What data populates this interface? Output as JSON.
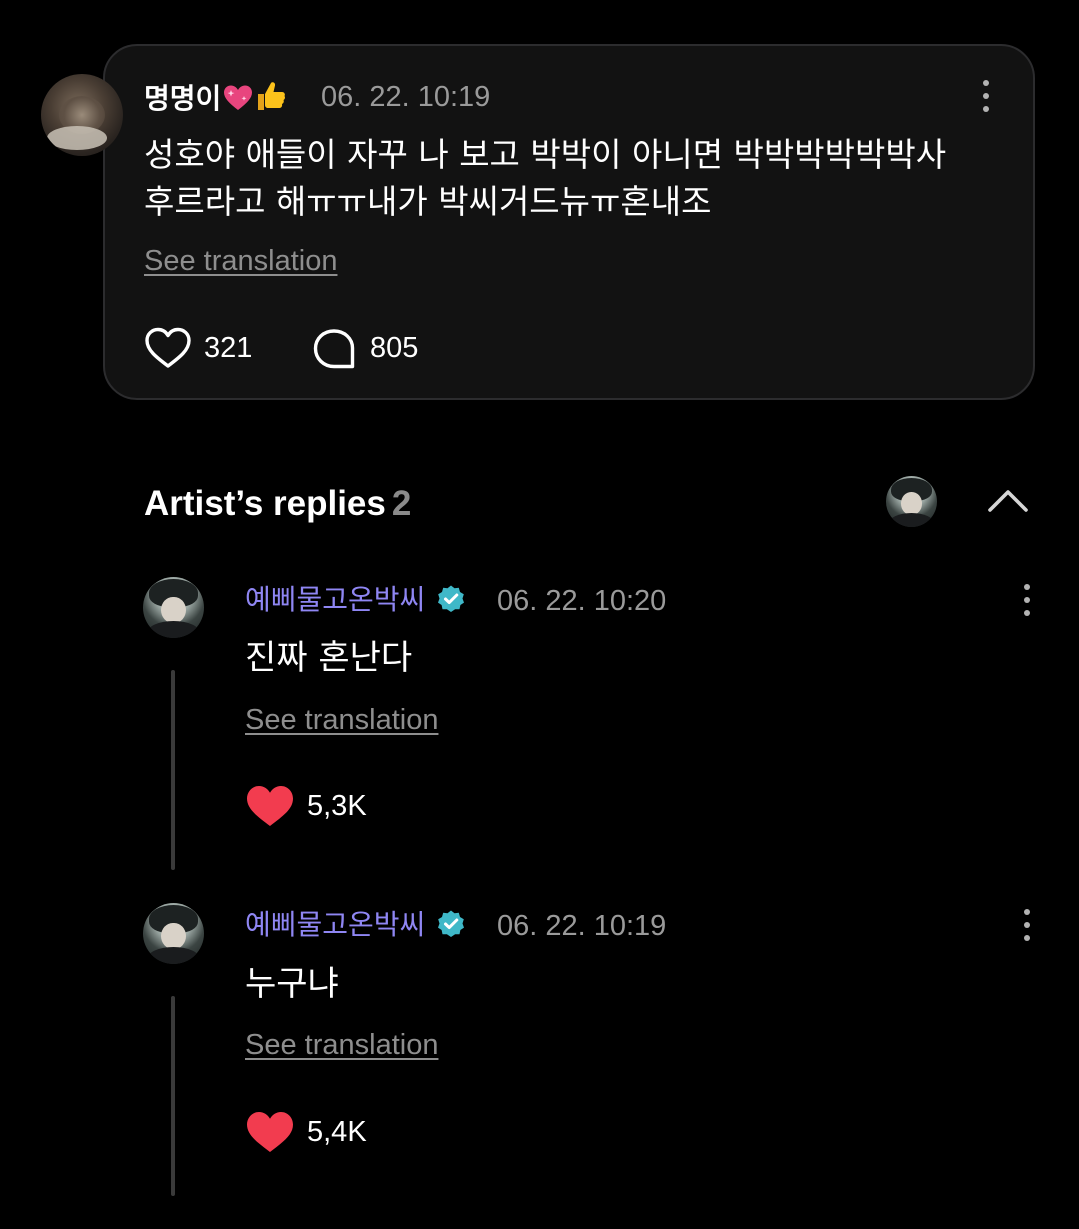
{
  "post": {
    "author": "명명이",
    "timestamp": "06. 22. 10:19",
    "text_line1": "성호야 애들이 자꾸 나 보고 박박이 아니면 박박박박박박사",
    "text_line2": "후르라고 해ㅠㅠ내가 박씨거드뉴ㅠ혼내조",
    "see_translation": "See translation",
    "likes": "321",
    "comments": "805"
  },
  "replies_section": {
    "title": "Artist’s replies",
    "count": "2"
  },
  "replies": [
    {
      "author": "예삐물고온박씨",
      "timestamp": "06. 22. 10:20",
      "text": "진짜 혼난다",
      "see_translation": "See translation",
      "likes": "5,3K"
    },
    {
      "author": "예삐물고온박씨",
      "timestamp": "06. 22. 10:19",
      "text": "누구냐",
      "see_translation": "See translation",
      "likes": "5,4K"
    }
  ],
  "colors": {
    "background": "#000000",
    "card": "#121212",
    "artist_name": "#8f86f3",
    "verified_badge": "#3fb8c8",
    "heart_filled": "#f23c4f",
    "muted_text": "#9a9a9a"
  },
  "icons": [
    "heart-outline-icon",
    "comment-bubble-icon",
    "more-vertical-icon",
    "verified-badge-icon",
    "heart-filled-icon",
    "chevron-up-icon",
    "sparkling-heart-emoji",
    "thumbs-up-emoji"
  ]
}
